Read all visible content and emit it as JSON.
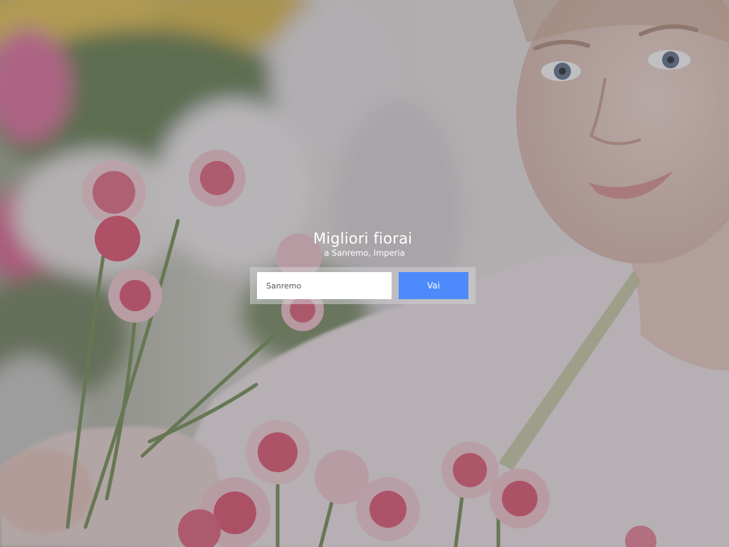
{
  "hero": {
    "title": "Migliori fiorai",
    "subtitle": "a Sanremo, Imperia"
  },
  "search": {
    "value": "Sanremo",
    "placeholder": "Sanremo",
    "button_label": "Vai",
    "button_color": "#4d8afc"
  },
  "background": {
    "scene": "florist holding pink carnations"
  }
}
